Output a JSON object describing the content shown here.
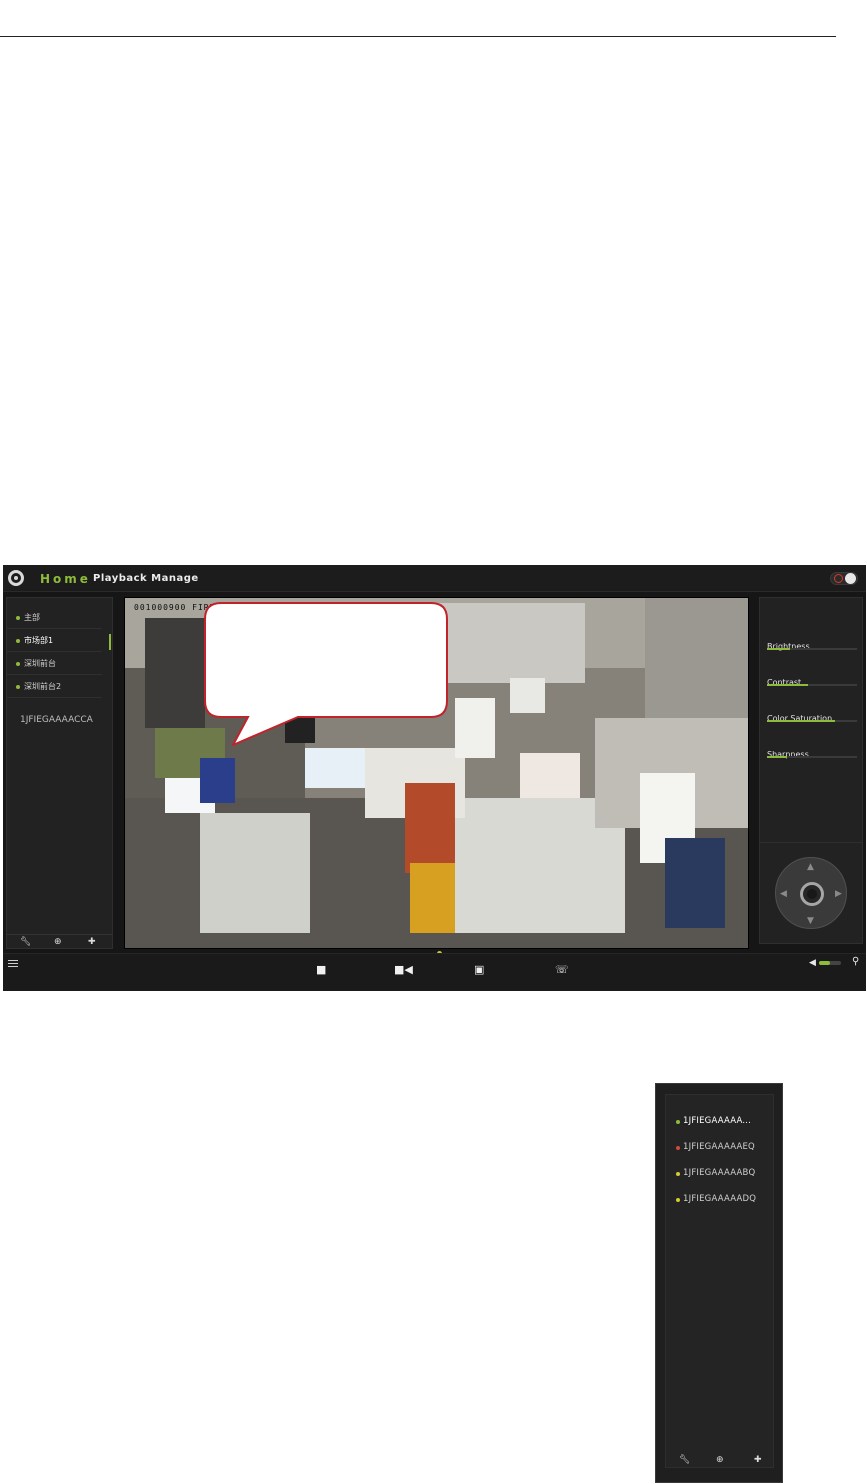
{
  "app": {
    "nav_home": "Home",
    "nav_playback": "Playback Manage"
  },
  "tree": {
    "items": [
      {
        "label": "主部",
        "dot_color": "#8dbb3a"
      },
      {
        "label": "市场部1",
        "dot_color": "#8dbb3a"
      },
      {
        "label": "深圳前台",
        "dot_color": "#8dbb3a"
      },
      {
        "label": "深圳前台2",
        "dot_color": "#8dbb3a"
      }
    ],
    "active_index": 1,
    "device": "1JFIEGAAAACCA",
    "tools": [
      "wrench-icon",
      "zoom-icon",
      "add-icon"
    ]
  },
  "video": {
    "osd_text": "001000900 FIRR"
  },
  "image_adjust": {
    "items": [
      {
        "label": "Brightness",
        "level": 0.25
      },
      {
        "label": "Contrast",
        "level": 0.45
      },
      {
        "label": "Color Saturation",
        "level": 0.75
      },
      {
        "label": "Sharpness",
        "level": 0.22
      }
    ]
  },
  "toolbar": {
    "icons": [
      "stop-icon",
      "record-icon",
      "snapshot-icon",
      "talk-icon"
    ],
    "volume_level": 0.5
  },
  "device_list": {
    "items": [
      {
        "label": "1JFIEGAAAAA...",
        "status_color": "#8dbb3a"
      },
      {
        "label": "1JFIEGAAAAAEQ",
        "status_color": "#d04a3a"
      },
      {
        "label": "1JFIEGAAAAABQ",
        "status_color": "#d8c832"
      },
      {
        "label": "1JFIEGAAAAADQ",
        "status_color": "#d8c832"
      }
    ],
    "selected_index": 0
  },
  "colors": {
    "accent": "#8dbb3a",
    "panel": "#222222",
    "power": "#d43a2a"
  }
}
